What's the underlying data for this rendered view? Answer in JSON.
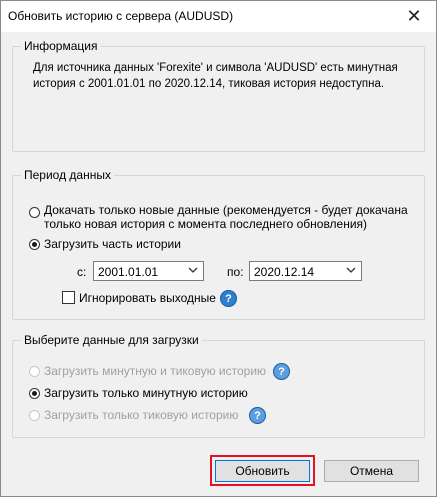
{
  "window": {
    "title": "Обновить историю с сервера (AUDUSD)",
    "close_glyph": "✕"
  },
  "info": {
    "label": "Информация",
    "line1": "Для источника данных 'Forexite' и символа 'AUDUSD' есть минутная",
    "line2": "история с 2001.01.01 по 2020.12.14, тиковая история недоступна."
  },
  "period": {
    "label": "Период данных",
    "option_new_line1": "Докачать только новые данные (рекомендуется - будет докачана",
    "option_new_line2": "только новая история с момента последнего обновления)",
    "option_part": "Загрузить часть истории",
    "from_label": "с:",
    "from_value": "2001.01.01",
    "to_label": "по:",
    "to_value": "2020.12.14",
    "ignore_weekends": "Игнорировать выходные",
    "help_glyph": "?"
  },
  "select": {
    "label": "Выберите данные для загрузки",
    "opt_minute_tick": "Загрузить минутную и тиковую историю",
    "opt_minute_only": "Загрузить только минутную историю",
    "opt_tick_only": "Загрузить только тиковую историю",
    "help_glyph": "?"
  },
  "buttons": {
    "update": "Обновить",
    "cancel": "Отмена"
  },
  "colors": {
    "highlight": "#e81123",
    "help_blue": "#2f7fd0",
    "primary_border": "#0078d7"
  }
}
